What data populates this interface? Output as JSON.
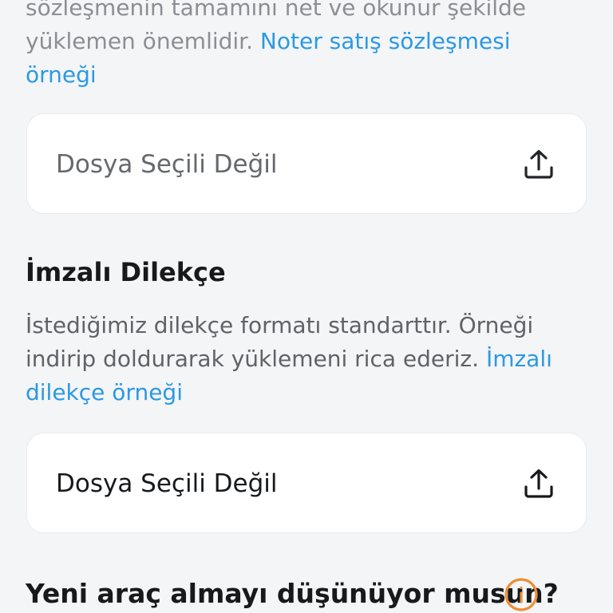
{
  "contract": {
    "desc_line1": "sözleşmenin tamamını net ve okunur şekilde",
    "desc_line2": "yüklemen önemlidir. ",
    "link_part1": "Noter satış sözleşmesi",
    "link_part2": "örneği",
    "upload_label": "Dosya Seçili Değil",
    "upload_icon": "upload-icon"
  },
  "petition": {
    "title": "İmzalı Dilekçe",
    "desc_line1": "İstediğimiz dilekçe formatı standarttır. Örneği",
    "desc_line2": "indirip doldurarak yüklemeni rica ederiz. ",
    "link_part1": "İmzalı",
    "link_part2": "dilekçe örneği",
    "upload_label": "Dosya Seçili Değil",
    "upload_icon": "upload-icon"
  },
  "new_car": {
    "question": "Yeni araç almayı düşünüyor musun?",
    "info_icon": "info-icon",
    "info_color": "#ee8d35"
  },
  "colors": {
    "link": "#2b99e3",
    "background": "#f4f5f7"
  }
}
